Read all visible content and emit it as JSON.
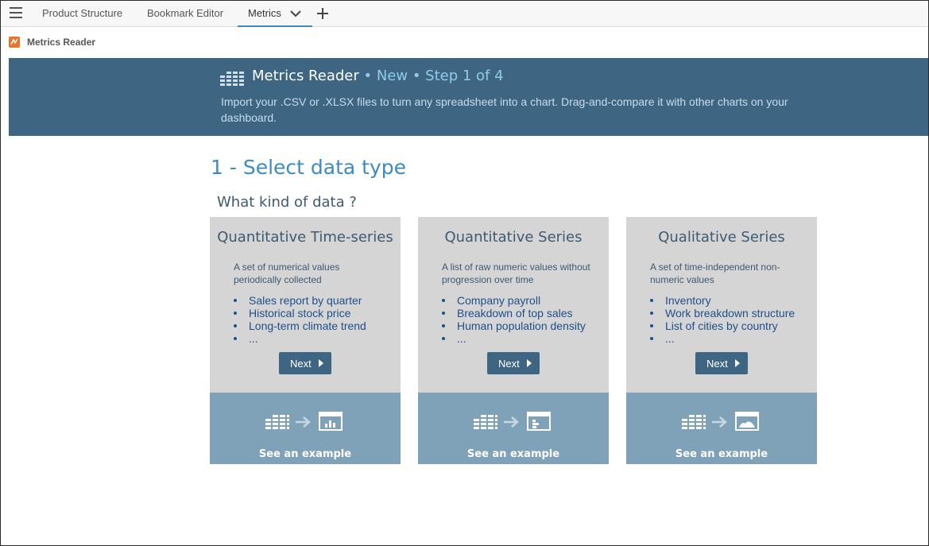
{
  "tabs": {
    "product_structure": "Product Structure",
    "bookmark_editor": "Bookmark Editor",
    "metrics": "Metrics"
  },
  "app": {
    "title": "Metrics Reader"
  },
  "banner": {
    "title": "Metrics Reader",
    "step": "• New • Step 1 of 4",
    "description": "Import your .CSV or .XLSX files to turn any spreadsheet into a chart. Drag-and-compare it with other charts on your dashboard."
  },
  "heading": "1 - Select data type",
  "subheading": "What kind of data ?",
  "cards": [
    {
      "title": "Quantitative Time-series",
      "description": "A set of numerical values periodically collected",
      "items": [
        "Sales report by quarter",
        "Historical stock price",
        "Long-term climate trend",
        "..."
      ],
      "next_label": "Next",
      "example_label": "See an example",
      "example_icon": "bar-chart-icon"
    },
    {
      "title": "Quantitative Series",
      "description": "A list of raw numeric values without progression over time",
      "items": [
        "Company payroll",
        "Breakdown of top sales",
        "Human population density",
        "..."
      ],
      "next_label": "Next",
      "example_label": "See an example",
      "example_icon": "horizontal-bar-chart-icon"
    },
    {
      "title": "Qualitative Series",
      "description": "A set of time-independent non-numeric values",
      "items": [
        "Inventory",
        "Work breakdown structure",
        "List of cities by country",
        "..."
      ],
      "next_label": "Next",
      "example_label": "See an example",
      "example_icon": "area-chart-icon"
    }
  ],
  "colors": {
    "banner": "#3e6683",
    "accent": "#3d8bc2",
    "card_top": "#d5d5d6",
    "card_bottom": "#7fa2b8",
    "logo": "#e8742b"
  }
}
